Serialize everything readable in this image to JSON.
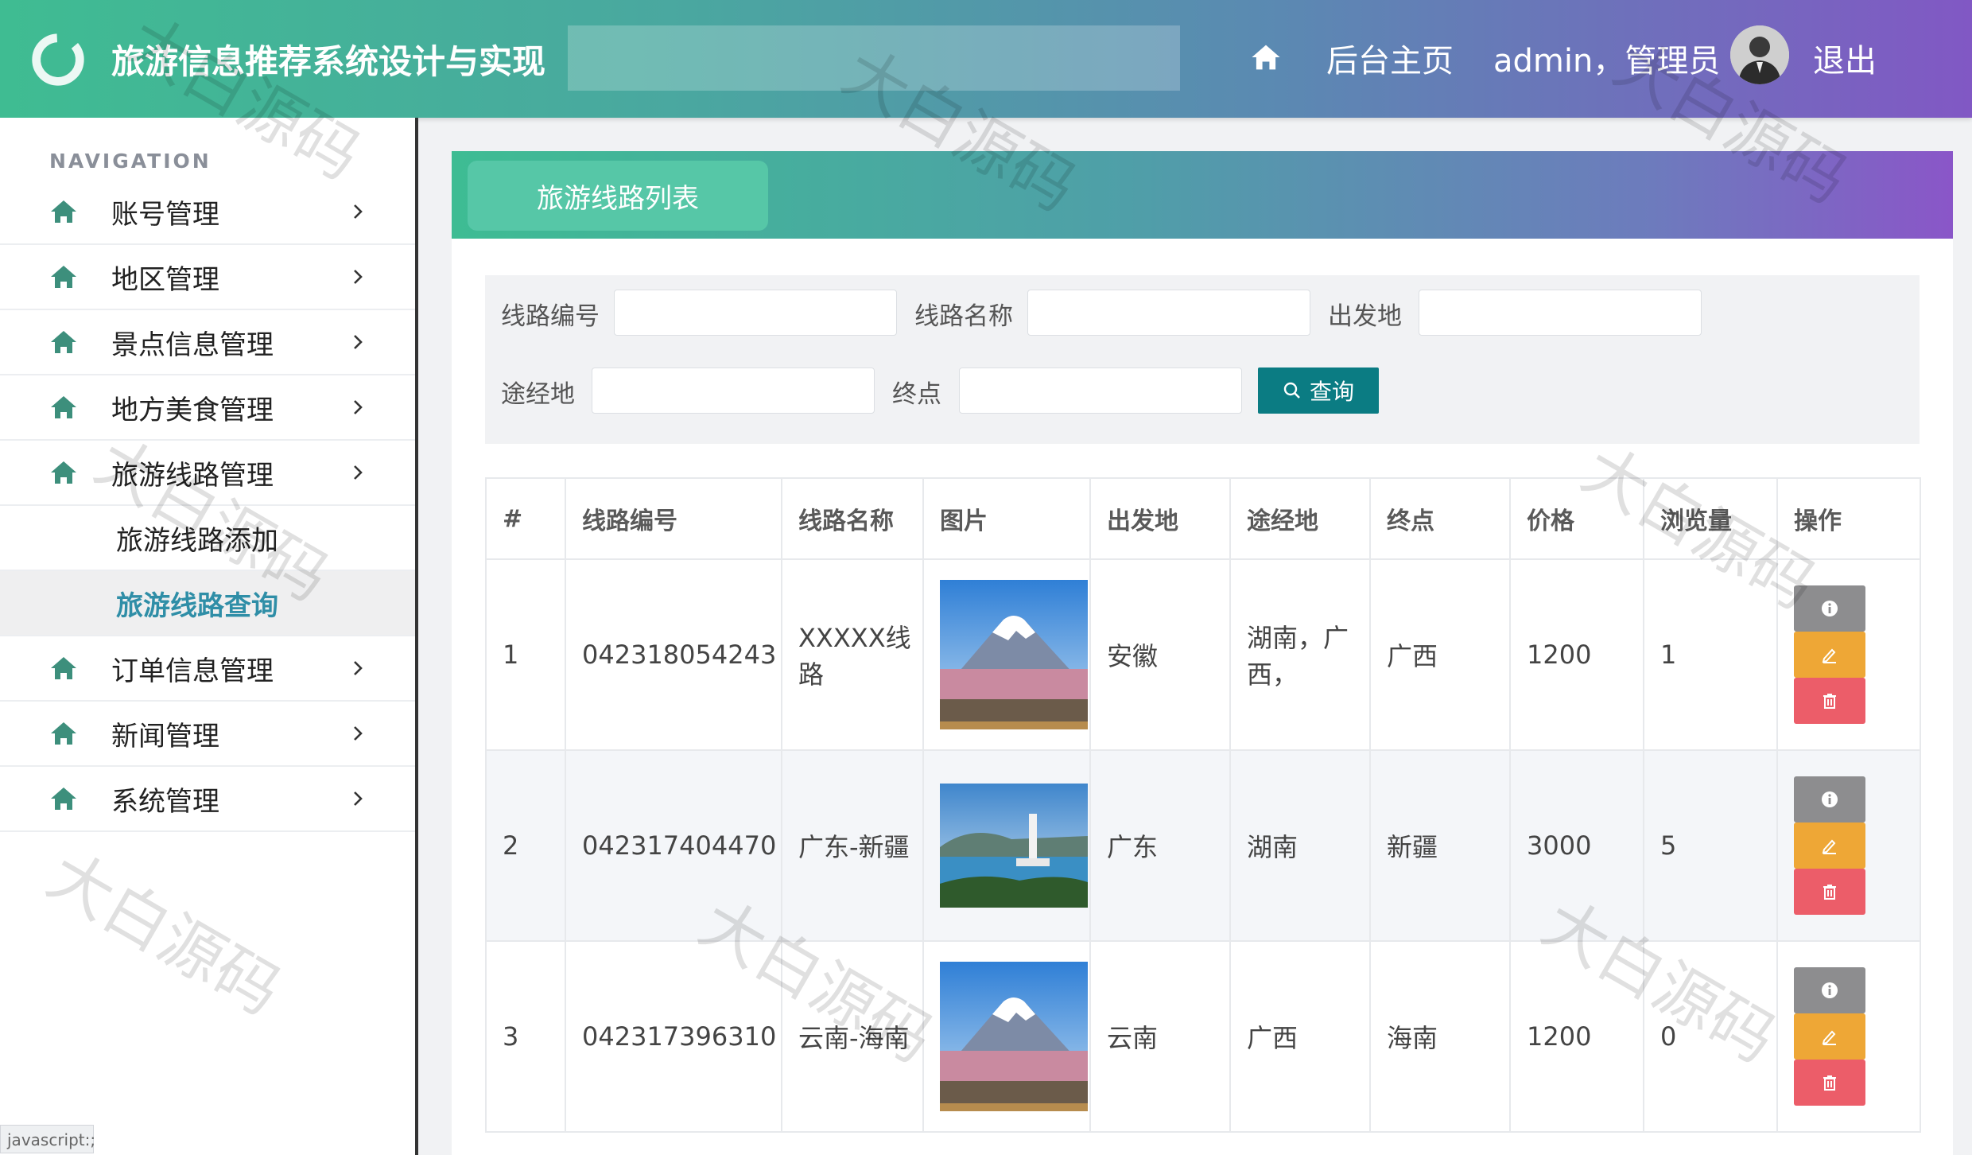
{
  "header": {
    "title": "旅游信息推荐系统设计与实现",
    "home_link": "后台主页",
    "user": "admin，管理员",
    "logout": "退出"
  },
  "sidebar": {
    "heading": "NAVIGATION",
    "items": [
      {
        "label": "账号管理"
      },
      {
        "label": "地区管理"
      },
      {
        "label": "景点信息管理"
      },
      {
        "label": "地方美食管理"
      },
      {
        "label": "旅游线路管理"
      },
      {
        "label": "订单信息管理"
      },
      {
        "label": "新闻管理"
      },
      {
        "label": "系统管理"
      }
    ],
    "subitems": [
      {
        "label": "旅游线路添加"
      },
      {
        "label": "旅游线路查询"
      }
    ]
  },
  "status_bar": "javascript:;",
  "panel": {
    "tab": "旅游线路列表"
  },
  "filters": {
    "route_no": "线路编号",
    "route_name": "线路名称",
    "departure": "出发地",
    "via": "途经地",
    "destination": "终点",
    "query": "查询"
  },
  "table": {
    "headers": [
      "#",
      "线路编号",
      "线路名称",
      "图片",
      "出发地",
      "途经地",
      "终点",
      "价格",
      "浏览量",
      "操作"
    ],
    "rows": [
      {
        "idx": "1",
        "code": "042318054243",
        "name": "XXXXX线路",
        "from": "安徽",
        "via": "湖南，广西，",
        "to": "广西",
        "price": "1200",
        "views": "1"
      },
      {
        "idx": "2",
        "code": "042317404470",
        "name": "广东-新疆",
        "from": "广东",
        "via": "湖南",
        "to": "新疆",
        "price": "3000",
        "views": "5"
      },
      {
        "idx": "3",
        "code": "042317396310",
        "name": "云南-海南",
        "from": "云南",
        "via": "广西",
        "to": "海南",
        "price": "1200",
        "views": "0"
      }
    ]
  },
  "watermark": "大白源码"
}
